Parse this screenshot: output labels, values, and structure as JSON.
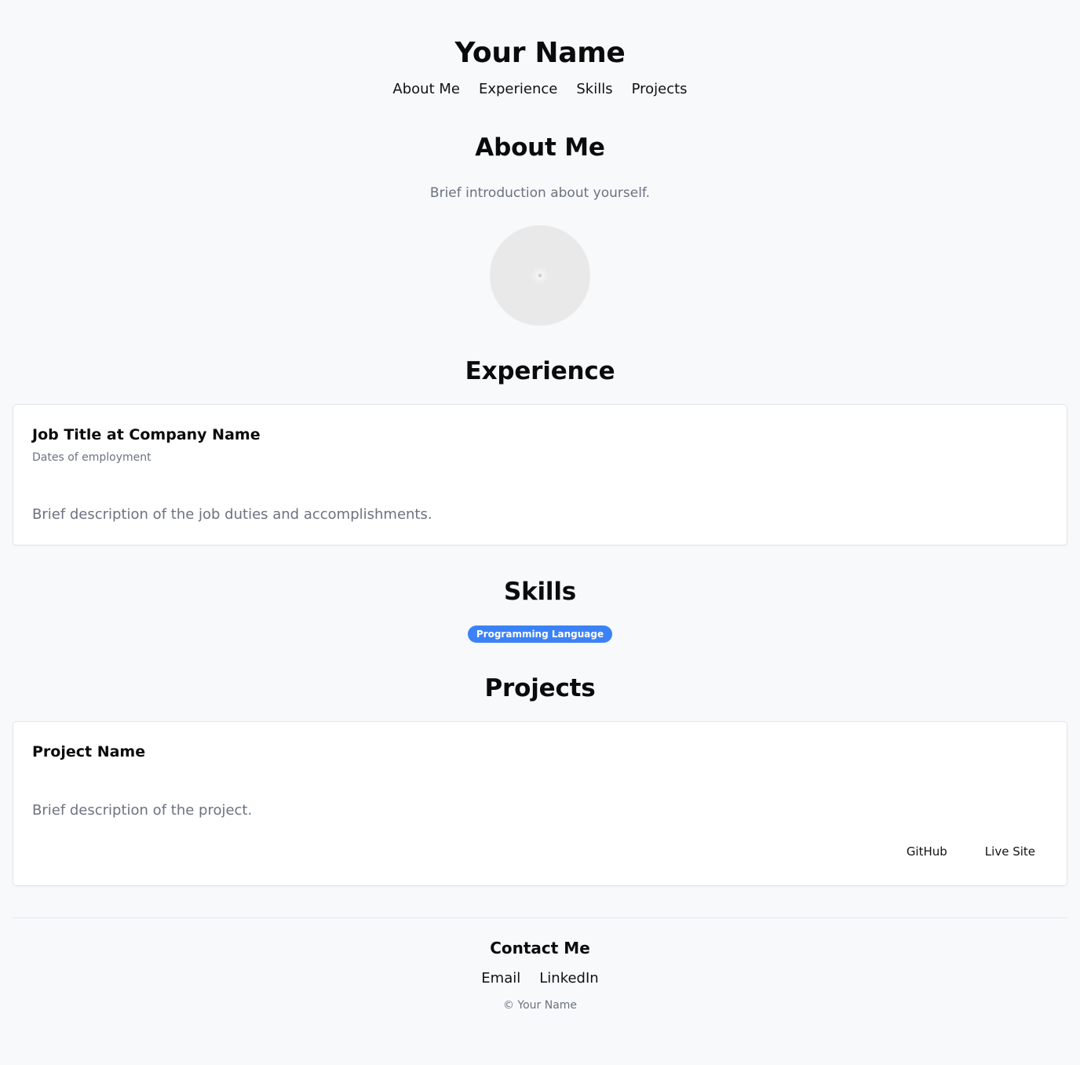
{
  "header": {
    "title": "Your Name",
    "nav": [
      {
        "label": "About Me"
      },
      {
        "label": "Experience"
      },
      {
        "label": "Skills"
      },
      {
        "label": "Projects"
      }
    ]
  },
  "about": {
    "heading": "About Me",
    "intro": "Brief introduction about yourself.",
    "avatar_icon": "image-placeholder-icon"
  },
  "experience": {
    "heading": "Experience",
    "items": [
      {
        "title": "Job Title at Company Name",
        "dates": "Dates of employment",
        "description": "Brief description of the job duties and accomplishments."
      }
    ]
  },
  "skills": {
    "heading": "Skills",
    "badges": [
      "Programming Language"
    ],
    "badge_color": "#3b82f6"
  },
  "projects": {
    "heading": "Projects",
    "items": [
      {
        "name": "Project Name",
        "description": "Brief description of the project.",
        "links": [
          "GitHub",
          "Live Site"
        ]
      }
    ]
  },
  "footer": {
    "heading": "Contact Me",
    "links": [
      "Email",
      "LinkedIn"
    ],
    "copyright": "© Your Name"
  }
}
